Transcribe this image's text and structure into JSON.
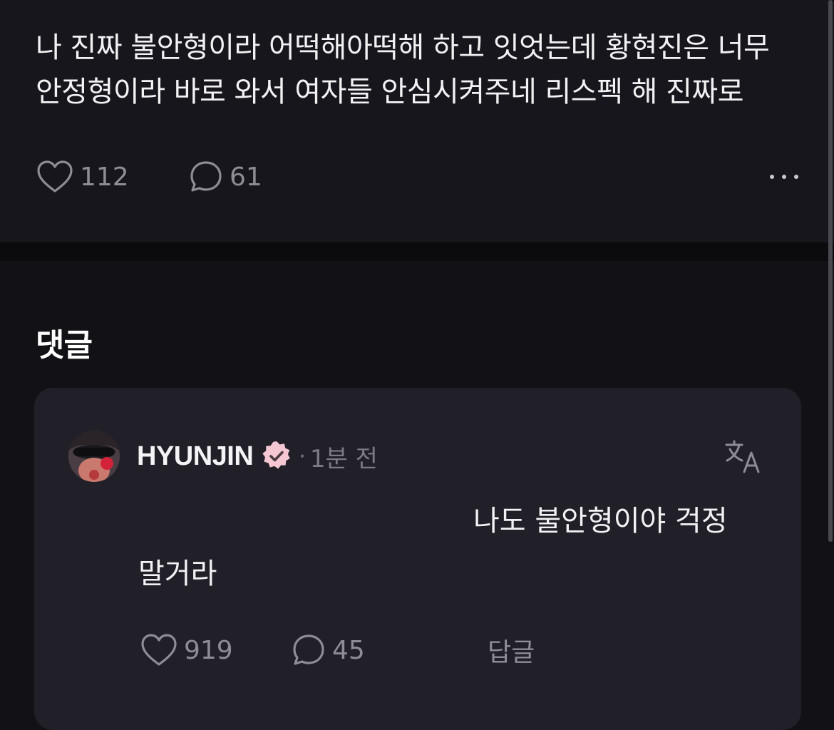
{
  "post": {
    "text_line1": "나 진짜 불안형이라 어떡해아떡해 하고 잇엇는데 황현진은 너무",
    "text_line2": "안정형이라 바로 와서 여자들 안심시켜주네 리스펙 해 진짜로",
    "likes": "112",
    "comments": "61",
    "icons": {
      "like": "heart-icon",
      "comment": "speech-bubble-icon",
      "more": "more-dots-icon"
    }
  },
  "comments_section": {
    "title": "댓글"
  },
  "comment": {
    "author": "HYUNJIN",
    "separator": "·",
    "time": "1분 전",
    "text_line1": "나도 불안형이야 걱정",
    "text_line2": "말거라",
    "likes": "919",
    "replies": "45",
    "reply_label": "답글",
    "badge_color": "#f4c7d3",
    "icons": {
      "verified": "verified-badge-icon",
      "translate": "translate-icon",
      "like": "heart-icon",
      "comment": "speech-bubble-icon"
    }
  },
  "colors": {
    "background": "#121116",
    "post_background": "#17161c",
    "card_background": "#211f27",
    "muted_text": "#8e8d95",
    "primary_text": "#f2f2f4"
  }
}
